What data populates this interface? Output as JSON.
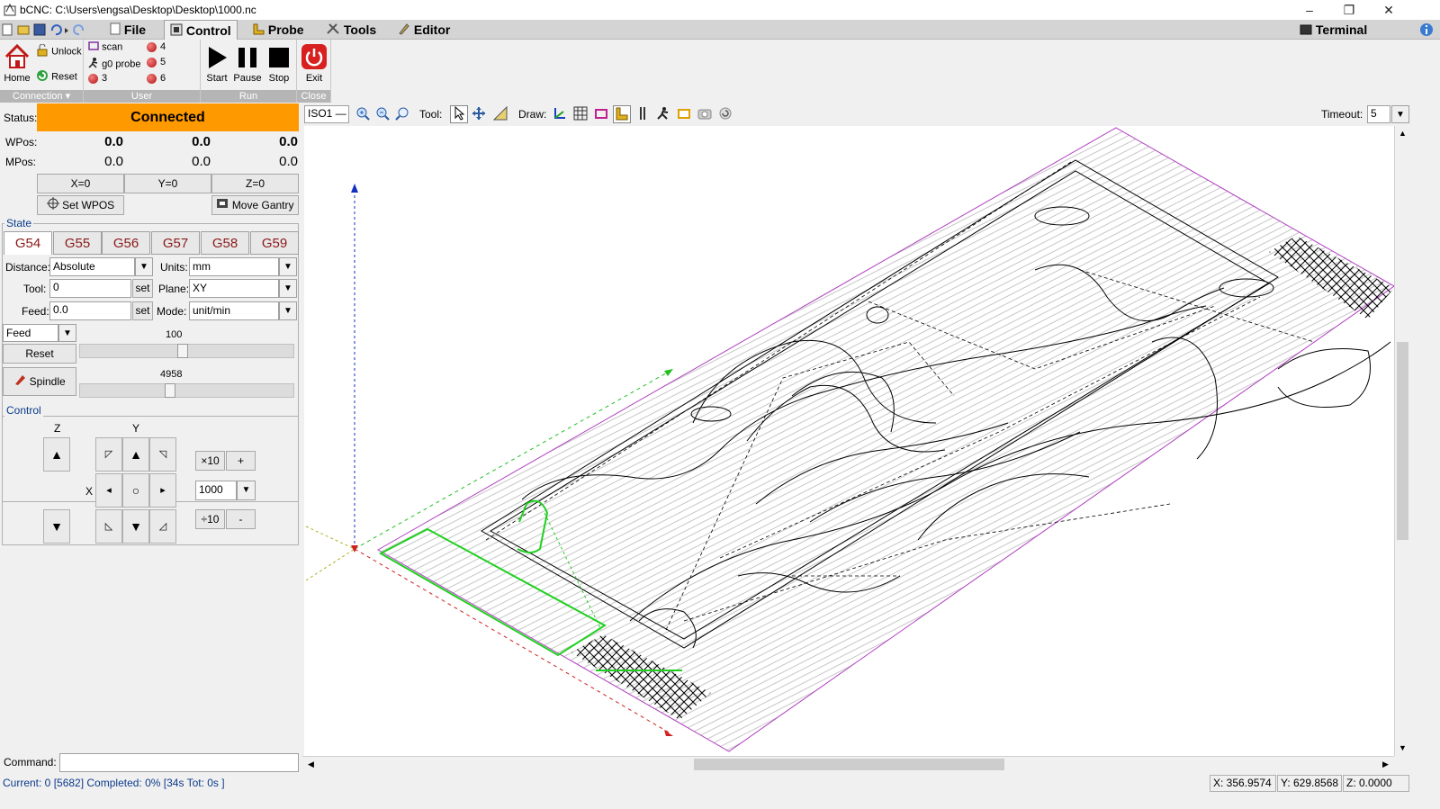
{
  "window": {
    "title": "bCNC: C:\\Users\\engsa\\Desktop\\Desktop\\1000.nc",
    "minimize": "–",
    "maximize": "❐",
    "close": "✕"
  },
  "menu": {
    "file": "File",
    "control": "Control",
    "probe": "Probe",
    "tools": "Tools",
    "editor": "Editor",
    "terminal": "Terminal"
  },
  "ribbon": {
    "connection": {
      "home": "Home",
      "unlock": "Unlock",
      "reset": "Reset",
      "label": "Connection ▾"
    },
    "user": {
      "scan": "scan",
      "g0probe": "g0 probe",
      "b3": "3",
      "b4": "4",
      "b5": "5",
      "b6": "6",
      "label": "User"
    },
    "run": {
      "start": "Start",
      "pause": "Pause",
      "stop": "Stop",
      "label": "Run"
    },
    "close": {
      "exit": "Exit",
      "label": "Close"
    }
  },
  "status": {
    "label": "Status:",
    "value": "Connected",
    "color": "#ff9900"
  },
  "pos": {
    "wpos_label": "WPos:",
    "mpos_label": "MPos:",
    "wx": "0.0",
    "wy": "0.0",
    "wz": "0.0",
    "mx": "0.0",
    "my": "0.0",
    "mz": "0.0",
    "x0": "X=0",
    "y0": "Y=0",
    "z0": "Z=0",
    "set_wpos": "Set WPOS",
    "move_gantry": "Move Gantry"
  },
  "state": {
    "label": "State",
    "tabs": [
      "G54",
      "G55",
      "G56",
      "G57",
      "G58",
      "G59"
    ],
    "distance_label": "Distance:",
    "distance": "Absolute",
    "units_label": "Units:",
    "units": "mm",
    "tool_label": "Tool:",
    "tool": "0",
    "set": "set",
    "plane_label": "Plane:",
    "plane": "XY",
    "feed_label": "Feed:",
    "feed": "0.0",
    "mode_label": "Mode:",
    "mode": "unit/min",
    "override": "Feed",
    "override_val": "100",
    "override_level": 100,
    "reset": "Reset",
    "spindle": "Spindle",
    "spindle_val": "4958",
    "spindle_level": 4958
  },
  "control": {
    "label": "Control",
    "z": "Z",
    "y": "Y",
    "x": "X",
    "x10": "×10",
    "plus": "+",
    "step": "1000",
    "div10": "÷10",
    "minus": "-"
  },
  "canvas": {
    "view": "ISO1",
    "tool_label": "Tool:",
    "draw_label": "Draw:",
    "timeout_label": "Timeout:",
    "timeout": "5"
  },
  "command": {
    "label": "Command:",
    "value": ""
  },
  "statusbar": {
    "left": "Current: 0 [5682]  Completed: 0% [34s Tot: 0s ]",
    "x": "X: 356.9574",
    "y": "Y: 629.8568",
    "z": "Z: 0.0000"
  }
}
